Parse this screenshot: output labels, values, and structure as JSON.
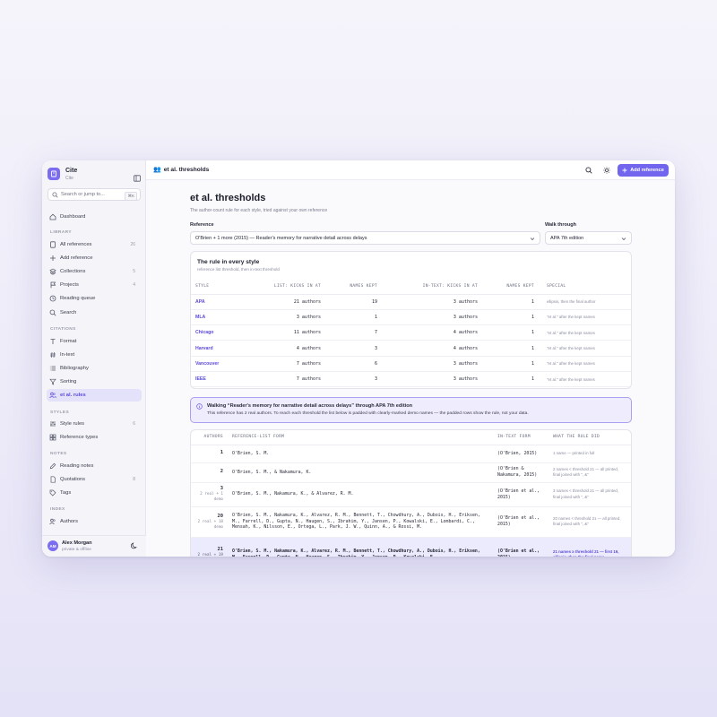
{
  "app": {
    "name": "Cite",
    "subtitle": "Cite"
  },
  "search": {
    "placeholder": "Search or jump to...",
    "shortcut": "⌘K"
  },
  "nav": {
    "dashboard": "Dashboard",
    "library_label": "LIBRARY",
    "library": [
      {
        "label": "All references",
        "count": "26"
      },
      {
        "label": "Add reference",
        "count": ""
      },
      {
        "label": "Collections",
        "count": "5"
      },
      {
        "label": "Projects",
        "count": "4"
      },
      {
        "label": "Reading queue",
        "count": ""
      },
      {
        "label": "Search",
        "count": ""
      }
    ],
    "citations_label": "CITATIONS",
    "citations": [
      {
        "label": "Format"
      },
      {
        "label": "In-text"
      },
      {
        "label": "Bibliography"
      },
      {
        "label": "Sorting"
      },
      {
        "label": "et al. rules"
      }
    ],
    "styles_label": "STYLES",
    "styles": [
      {
        "label": "Style rules",
        "count": "6"
      },
      {
        "label": "Reference types",
        "count": ""
      }
    ],
    "notes_label": "NOTES",
    "notes": [
      {
        "label": "Reading notes",
        "count": ""
      },
      {
        "label": "Quotations",
        "count": "8"
      },
      {
        "label": "Tags",
        "count": ""
      }
    ],
    "index_label": "INDEX",
    "index": [
      {
        "label": "Authors"
      }
    ]
  },
  "user": {
    "initials": "AM",
    "name": "Alex Morgan",
    "status": "private & offline"
  },
  "topbar": {
    "title": "et al. thresholds",
    "add_button": "Add reference"
  },
  "page": {
    "title": "et al. thresholds",
    "subtitle": "The author-count rule for each style, tried against your own reference",
    "reference_label": "Reference",
    "reference_value": "O'Brien + 1 more (2015) — Reader's memory for narrative detail across delays",
    "walk_label": "Walk through",
    "walk_value": "APA 7th edition"
  },
  "rules_card": {
    "title": "The rule in every style",
    "subtitle": "reference list threshold, then in-text threshold",
    "headers": [
      "STYLE",
      "LIST: KICKS IN AT",
      "NAMES KEPT",
      "IN-TEXT: KICKS IN AT",
      "NAMES KEPT",
      "SPECIAL"
    ],
    "rows": [
      {
        "style": "APA",
        "list_at": "21 authors",
        "list_kept": "19",
        "text_at": "3 authors",
        "text_kept": "1",
        "special": "ellipsis, then the final author"
      },
      {
        "style": "MLA",
        "list_at": "3 authors",
        "list_kept": "1",
        "text_at": "3 authors",
        "text_kept": "1",
        "special": "\"et al.\" after the kept names"
      },
      {
        "style": "Chicago",
        "list_at": "11 authors",
        "list_kept": "7",
        "text_at": "4 authors",
        "text_kept": "1",
        "special": "\"et al.\" after the kept names"
      },
      {
        "style": "Harvard",
        "list_at": "4 authors",
        "list_kept": "3",
        "text_at": "4 authors",
        "text_kept": "1",
        "special": "\"et al.\" after the kept names"
      },
      {
        "style": "Vancouver",
        "list_at": "7 authors",
        "list_kept": "6",
        "text_at": "3 authors",
        "text_kept": "1",
        "special": "\"et al.\" after the kept names"
      },
      {
        "style": "IEEE",
        "list_at": "7 authors",
        "list_kept": "3",
        "text_at": "3 authors",
        "text_kept": "1",
        "special": "\"et al.\" after the kept names"
      }
    ]
  },
  "callout": {
    "title": "Walking “Reader's memory for narrative detail across delays” through APA 7th edition",
    "body": "This reference has 2 real authors. To reach each threshold the list below is padded with clearly-marked demo names — the padded rows show the rule, not your data."
  },
  "walk_table": {
    "headers": [
      "AUTHORS",
      "REFERENCE-LIST FORM",
      "IN-TEXT FORM",
      "WHAT THE RULE DID"
    ],
    "rows": [
      {
        "n": "1",
        "pad": "",
        "list": "O'Brien, S. M.",
        "intext": "(O'Brien, 2015)",
        "did": "1 name — printed in full"
      },
      {
        "n": "2",
        "pad": "",
        "list": "O'Brien, S. M., & Nakamura, K.",
        "intext": "(O'Brien & Nakamura, 2015)",
        "did": "2 names < threshold 21 — all printed, final joined with \", &\""
      },
      {
        "n": "3",
        "pad": "2 real + 1 demo",
        "list": "O'Brien, S. M., Nakamura, K., & Alvarez, R. M.",
        "intext": "(O'Brien et al., 2015)",
        "did": "3 names < threshold 21 — all printed, final joined with \", &\""
      },
      {
        "n": "20",
        "pad": "2 real + 18 demo",
        "list": "O'Brien, S. M., Nakamura, K., Alvarez, R. M., Bennett, T., Chowdhury, A., Dubois, H., Eriksen, M., Farrell, D., Gupta, N., Haugen, S., Ibrahim, Y., Jansen, P., Kowalski, E., Lombardi, C., Mensah, K., Nilsson, E., Ortega, L., Park, J. W., Quinn, A., & Rossi, M.",
        "intext": "(O'Brien et al., 2015)",
        "did": "20 names < threshold 21 — all printed, final joined with \", &\""
      },
      {
        "n": "21",
        "pad": "2 real + 19 demo",
        "list": "O'Brien, S. M., Nakamura, K., Alvarez, R. M., Bennett, T., Chowdhury, A., Dubois, H., Eriksen, M., Farrell, D., Gupta, N., Haugen, S., Ibrahim, Y., Jansen, P., Kowalski, E.,",
        "intext": "(O'Brien et al., 2015)",
        "did": "21 names ≥ threshold 21 — first 19, ellipsis, then the final name"
      }
    ]
  }
}
